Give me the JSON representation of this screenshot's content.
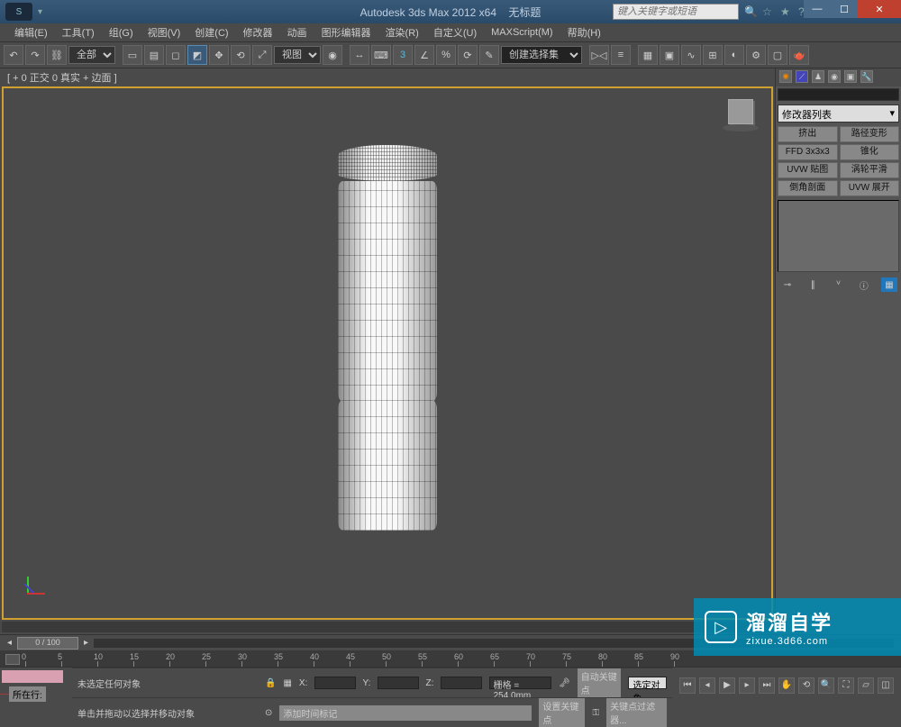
{
  "title": {
    "app": "Autodesk 3ds Max  2012  x64",
    "doc": "无标题",
    "search_placeholder": "键入关键字或短语"
  },
  "menu": {
    "items": [
      "编辑(E)",
      "工具(T)",
      "组(G)",
      "视图(V)",
      "创建(C)",
      "修改器",
      "动画",
      "图形编辑器",
      "渲染(R)",
      "自定义(U)",
      "MAXScript(M)",
      "帮助(H)"
    ]
  },
  "toolbar": {
    "set_dropdown": "全部",
    "view_dropdown": "视图",
    "selset_dropdown": "创建选择集"
  },
  "viewport": {
    "label": "[ + 0 正交 0 真实 + 边面 ]"
  },
  "right_panel": {
    "modifier_list": "修改器列表",
    "buttons": [
      [
        "挤出",
        "路径变形"
      ],
      [
        "FFD 3x3x3",
        "锥化"
      ],
      [
        "UVW 贴图",
        "涡轮平滑"
      ],
      [
        "倒角剖面",
        "UVW 展开"
      ]
    ]
  },
  "timeline": {
    "frame": "0 / 100",
    "ticks": [
      "0",
      "5",
      "10",
      "15",
      "20",
      "25",
      "30",
      "35",
      "40",
      "45",
      "50",
      "55",
      "60",
      "65",
      "70",
      "75",
      "80",
      "85",
      "90"
    ]
  },
  "status": {
    "selection": "未选定任何对象",
    "hint": "单击并拖动以选择并移动对象",
    "row_label": "所在行:",
    "add_marker": "添加时间标记",
    "coord_x": "X:",
    "coord_y": "Y:",
    "coord_z": "Z:",
    "grid_label": "栅格 = 254.0mm",
    "autokey": "自动关键点",
    "selkey": "选定对象",
    "setkey": "设置关键点",
    "keyfilter": "关键点过滤器..."
  },
  "watermark": {
    "main": "溜溜自学",
    "sub": "zixue.3d66.com"
  }
}
